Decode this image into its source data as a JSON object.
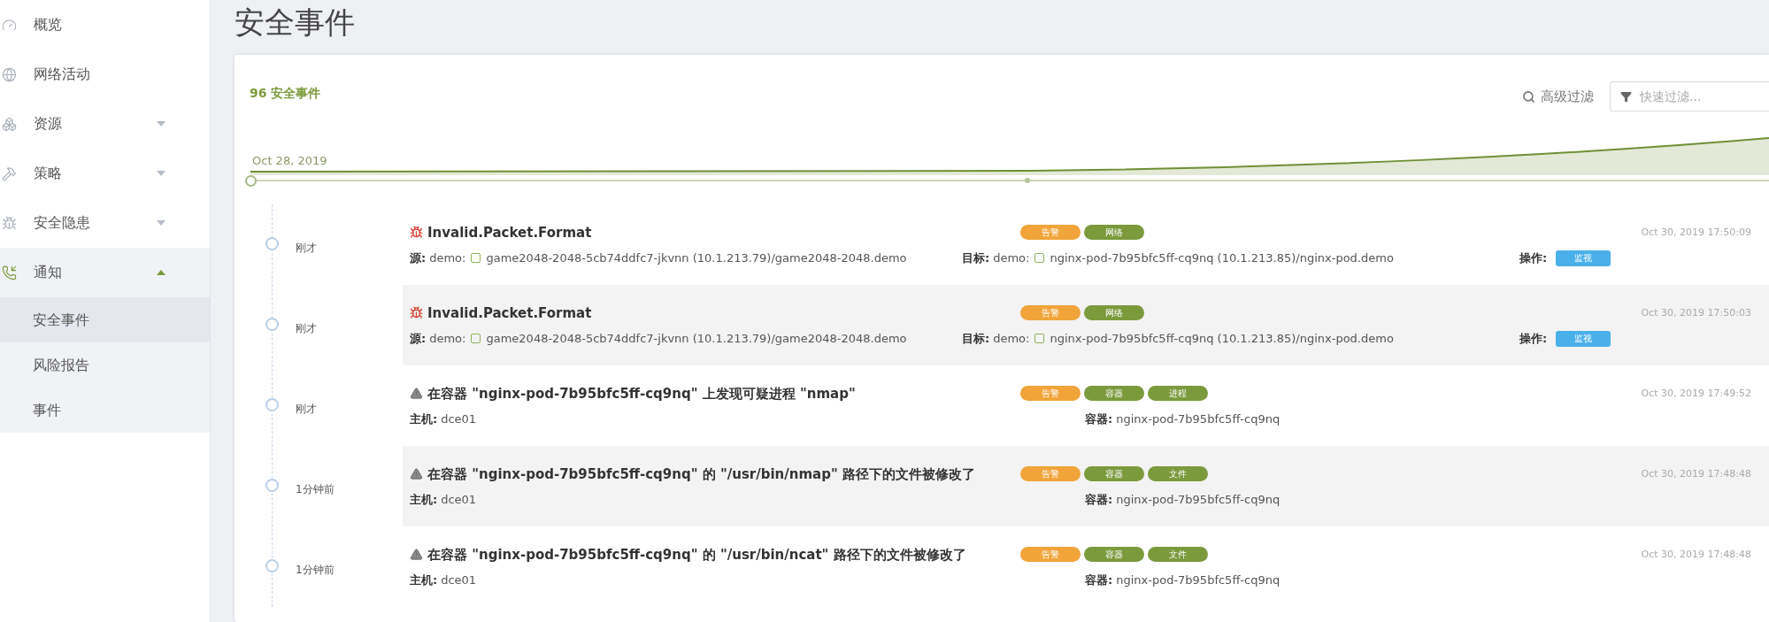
{
  "sidebar": {
    "items": [
      {
        "label": "概览",
        "selected": false
      },
      {
        "label": "网络活动",
        "selected": false
      },
      {
        "label": "资源",
        "selected": false,
        "expanded": false
      },
      {
        "label": "策略",
        "selected": false,
        "expanded": false
      },
      {
        "label": "安全隐患",
        "selected": false,
        "expanded": false
      },
      {
        "label": "通知",
        "selected": false,
        "expanded": true,
        "children": [
          {
            "label": "安全事件",
            "selected": true
          },
          {
            "label": "风险报告",
            "selected": false
          },
          {
            "label": "事件",
            "selected": false
          }
        ]
      }
    ]
  },
  "page_title": "安全事件",
  "card": {
    "count_title": "96 安全事件",
    "advanced_filter": "高级过滤",
    "quick_filter": {
      "placeholder": "快速过滤..."
    },
    "timeline": {
      "start_label": "Oct 28, 2019"
    },
    "events": [
      {
        "kind": "network",
        "time_ago": "刚才",
        "title": "Invalid.Packet.Format",
        "timestamp": "Oct 30, 2019 17:50:09",
        "tags": [
          {
            "label": "告警",
            "color": "#f0a43a"
          },
          {
            "label": "网络",
            "color": "#7b9a3c"
          }
        ],
        "details": [
          {
            "label": "源:",
            "namespace": "demo:",
            "value": "game2048-2048-5cb74ddfc7-jkvnn (10.1.213.79)/game2048-2048.demo"
          },
          {
            "label": "目标:",
            "namespace": "demo:",
            "value": "nginx-pod-7b95bfc5ff-cq9nq (10.1.213.85)/nginx-pod.demo"
          }
        ],
        "action": {
          "label": "操作:",
          "button": "监视"
        }
      },
      {
        "kind": "network",
        "time_ago": "刚才",
        "title": "Invalid.Packet.Format",
        "timestamp": "Oct 30, 2019 17:50:03",
        "tags": [
          {
            "label": "告警",
            "color": "#f0a43a"
          },
          {
            "label": "网络",
            "color": "#7b9a3c"
          }
        ],
        "details": [
          {
            "label": "源:",
            "namespace": "demo:",
            "value": "game2048-2048-5cb74ddfc7-jkvnn (10.1.213.79)/game2048-2048.demo"
          },
          {
            "label": "目标:",
            "namespace": "demo:",
            "value": "nginx-pod-7b95bfc5ff-cq9nq (10.1.213.85)/nginx-pod.demo"
          }
        ],
        "action": {
          "label": "操作:",
          "button": "监视"
        }
      },
      {
        "kind": "container",
        "time_ago": "刚才",
        "title": "在容器 \"nginx-pod-7b95bfc5ff-cq9nq\" 上发现可疑进程 \"nmap\"",
        "timestamp": "Oct 30, 2019 17:49:52",
        "tags": [
          {
            "label": "告警",
            "color": "#f0a43a"
          },
          {
            "label": "容器",
            "color": "#7b9a3c"
          },
          {
            "label": "进程",
            "color": "#7b9a3c"
          }
        ],
        "details": [
          {
            "label": "主机:",
            "value": "dce01"
          },
          {
            "label": "容器:",
            "value": "nginx-pod-7b95bfc5ff-cq9nq"
          }
        ]
      },
      {
        "kind": "container",
        "time_ago": "1分钟前",
        "title": "在容器 \"nginx-pod-7b95bfc5ff-cq9nq\" 的 \"/usr/bin/nmap\" 路径下的文件被修改了",
        "timestamp": "Oct 30, 2019 17:48:48",
        "tags": [
          {
            "label": "告警",
            "color": "#f0a43a"
          },
          {
            "label": "容器",
            "color": "#7b9a3c"
          },
          {
            "label": "文件",
            "color": "#7b9a3c"
          }
        ],
        "details": [
          {
            "label": "主机:",
            "value": "dce01"
          },
          {
            "label": "容器:",
            "value": "nginx-pod-7b95bfc5ff-cq9nq"
          }
        ]
      },
      {
        "kind": "container",
        "time_ago": "1分钟前",
        "title": "在容器 \"nginx-pod-7b95bfc5ff-cq9nq\" 的 \"/usr/bin/ncat\" 路径下的文件被修改了",
        "timestamp": "Oct 30, 2019 17:48:48",
        "tags": [
          {
            "label": "告警",
            "color": "#f0a43a"
          },
          {
            "label": "容器",
            "color": "#7b9a3c"
          },
          {
            "label": "文件",
            "color": "#7b9a3c"
          }
        ],
        "details": [
          {
            "label": "主机:",
            "value": "dce01"
          },
          {
            "label": "容器:",
            "value": "nginx-pod-7b95bfc5ff-cq9nq"
          }
        ]
      }
    ]
  }
}
